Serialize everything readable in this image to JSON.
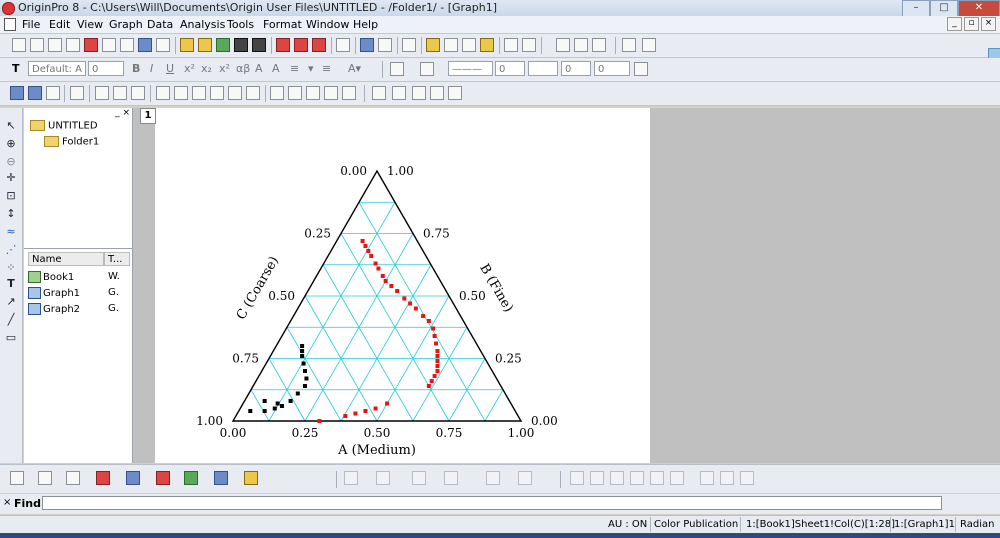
{
  "window": {
    "title": "OriginPro 8 - C:\\Users\\Will\\Documents\\Origin User Files\\UNTITLED - /Folder1/ - [Graph1]"
  },
  "menu": [
    "File",
    "Edit",
    "View",
    "Graph",
    "Data",
    "Analysis",
    "Tools",
    "Format",
    "Window",
    "Help"
  ],
  "format_toolbar": {
    "font": "Default: A",
    "size": "0",
    "bold": "B",
    "italic": "I",
    "underline": "U",
    "line_width_1": "0",
    "line_width_2": "0",
    "line_width_3": "0"
  },
  "project_explorer": {
    "root": "UNTITLED",
    "folder": "Folder1",
    "columns": [
      "Name",
      "T..."
    ],
    "items": [
      {
        "name": "Book1",
        "type": "W."
      },
      {
        "name": "Graph1",
        "type": "G."
      },
      {
        "name": "Graph2",
        "type": "G."
      }
    ]
  },
  "page_tab": "1",
  "chart_data": {
    "type": "scatter",
    "subtype": "ternary",
    "axes": {
      "A": {
        "label": "A (Medium)",
        "ticks": [
          "0.00",
          "0.25",
          "0.50",
          "0.75",
          "1.00"
        ]
      },
      "B": {
        "label": "B (Fine)",
        "ticks": [
          "0.00",
          "0.25",
          "0.50",
          "0.75",
          "1.00"
        ]
      },
      "C": {
        "label": "C (Coarse)",
        "ticks": [
          "0.00",
          "0.25",
          "0.50",
          "0.75",
          "1.00"
        ]
      }
    },
    "grid": true,
    "grid_color": "#22ccdd",
    "series": [
      {
        "color": "#ee1111",
        "points": [
          [
            0.3,
            0.0
          ],
          [
            0.38,
            0.02
          ],
          [
            0.41,
            0.03
          ],
          [
            0.44,
            0.04
          ],
          [
            0.47,
            0.05
          ],
          [
            0.5,
            0.07
          ],
          [
            0.61,
            0.14
          ],
          [
            0.61,
            0.16
          ],
          [
            0.61,
            0.18
          ],
          [
            0.61,
            0.2
          ],
          [
            0.6,
            0.22
          ],
          [
            0.59,
            0.24
          ],
          [
            0.58,
            0.26
          ],
          [
            0.57,
            0.28
          ],
          [
            0.55,
            0.31
          ],
          [
            0.53,
            0.34
          ],
          [
            0.51,
            0.37
          ],
          [
            0.48,
            0.4
          ],
          [
            0.45,
            0.42
          ],
          [
            0.41,
            0.45
          ],
          [
            0.38,
            0.47
          ],
          [
            0.35,
            0.49
          ],
          [
            0.31,
            0.52
          ],
          [
            0.28,
            0.54
          ],
          [
            0.25,
            0.56
          ],
          [
            0.23,
            0.58
          ],
          [
            0.2,
            0.61
          ],
          [
            0.18,
            0.63
          ],
          [
            0.15,
            0.66
          ],
          [
            0.13,
            0.68
          ],
          [
            0.11,
            0.7
          ],
          [
            0.09,
            0.72
          ]
        ]
      },
      {
        "color": "#000000",
        "points": [
          [
            0.04,
            0.04
          ],
          [
            0.09,
            0.04
          ],
          [
            0.12,
            0.05
          ],
          [
            0.14,
            0.06
          ],
          [
            0.16,
            0.08
          ],
          [
            0.17,
            0.11
          ],
          [
            0.18,
            0.14
          ],
          [
            0.17,
            0.17
          ],
          [
            0.15,
            0.2
          ],
          [
            0.13,
            0.23
          ],
          [
            0.11,
            0.26
          ],
          [
            0.1,
            0.28
          ],
          [
            0.09,
            0.3
          ],
          [
            0.07,
            0.08
          ],
          [
            0.12,
            0.07
          ]
        ]
      }
    ]
  },
  "find": {
    "label": "Find:",
    "value": ""
  },
  "status": {
    "au": "AU : ON",
    "theme": "Color Publication",
    "cell": "1:[Book1]Sheet1!Col(C)[1:28]",
    "layer": "1:[Graph1]1",
    "angle": "Radian"
  },
  "icons": [
    "pointer-icon",
    "zoom-icon",
    "data-reader-icon",
    "text-tool-icon",
    "arrow-tool-icon",
    "line-tool-icon",
    "rectangle-tool-icon"
  ]
}
